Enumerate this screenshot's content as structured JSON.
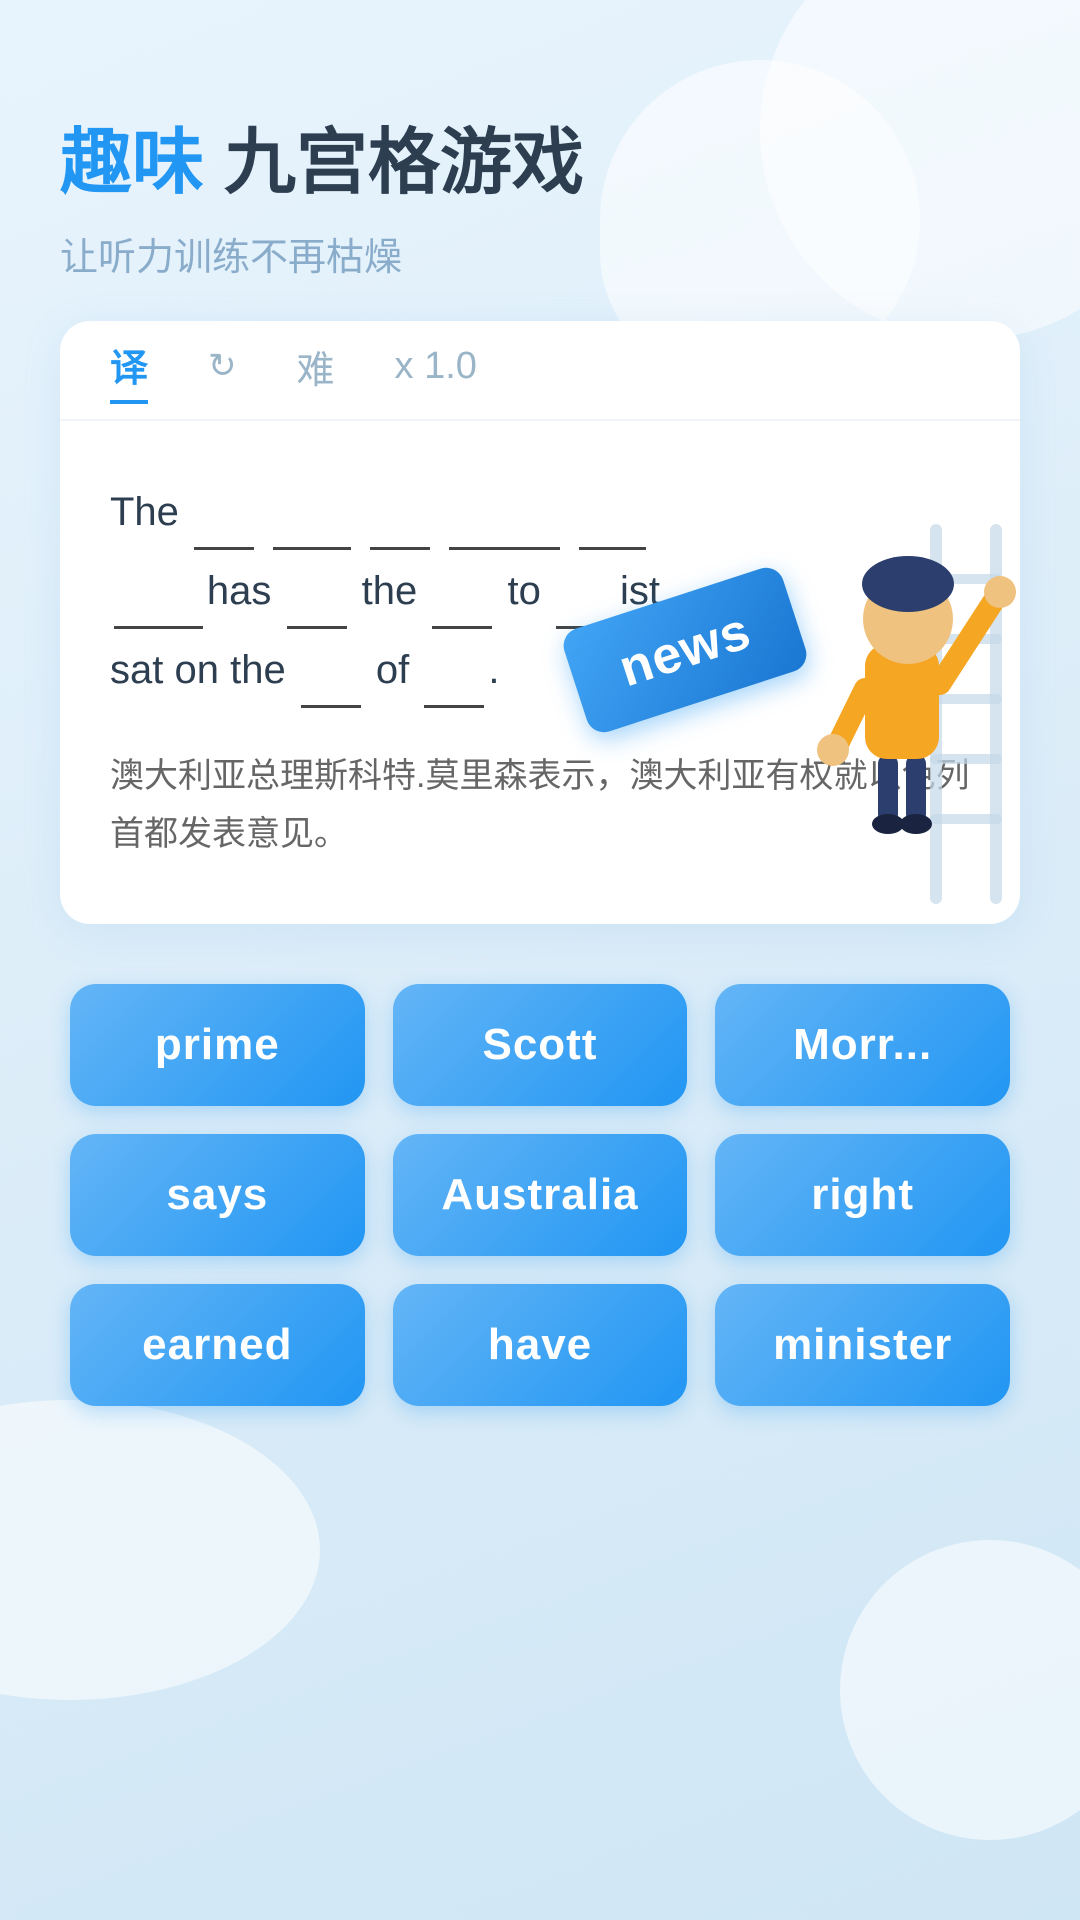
{
  "header": {
    "title_accent": "趣味",
    "title_normal": " 九宫格游戏",
    "subtitle": "让听力训练不再枯燥"
  },
  "card": {
    "tabs": [
      {
        "id": "translate",
        "label": "译",
        "active": true
      },
      {
        "id": "refresh",
        "label": "↻",
        "active": false
      },
      {
        "id": "difficulty",
        "label": "难",
        "active": false
      },
      {
        "id": "speed",
        "label": "x 1.0",
        "active": false
      }
    ],
    "sentence_parts": [
      "The ___ ______ ___ _________ ______",
      "________has ___ the ___ to _____ist",
      "sat on the ____ of _____."
    ],
    "translation": "澳大利亚总理斯科特.莫里森表示，澳大利亚有权就以色列首都发表意见。"
  },
  "floating_word": {
    "text": "news"
  },
  "word_grid": {
    "words": [
      {
        "id": "prime",
        "label": "prime"
      },
      {
        "id": "scott",
        "label": "Scott"
      },
      {
        "id": "morrison",
        "label": "Morr..."
      },
      {
        "id": "says",
        "label": "says"
      },
      {
        "id": "australia",
        "label": "Australia"
      },
      {
        "id": "right",
        "label": "right"
      },
      {
        "id": "earned",
        "label": "earned"
      },
      {
        "id": "have",
        "label": "have"
      },
      {
        "id": "minister",
        "label": "minister"
      }
    ]
  }
}
